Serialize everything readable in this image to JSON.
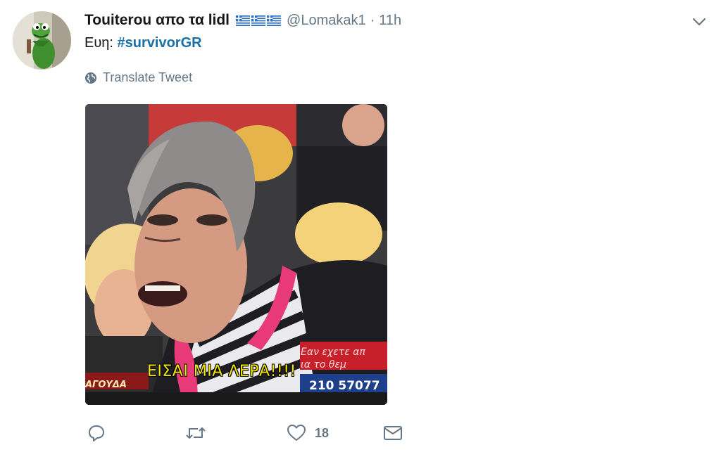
{
  "tweet": {
    "display_name": "Touiterou απο τα lidl",
    "flags": [
      "greece-flag",
      "greece-flag",
      "greece-flag"
    ],
    "handle": "@Lomakak1",
    "separator": "·",
    "time": "11h",
    "text_prefix": "Ευη: ",
    "hashtag": "#survivorGR",
    "translate_label": "Translate Tweet",
    "media": {
      "subtitle": "ΕΙΣΑΙ ΜΙΑ ΛΕΡΑ!!!!",
      "ticker_line1": "Εαν εχετε απ",
      "ticker_line2": "ια  το θεμ",
      "phone": "210 57077",
      "location": "ΑΓΟΥΔΑ"
    },
    "actions": {
      "reply_icon": "reply-icon",
      "retweet_icon": "retweet-icon",
      "like_icon": "heart-icon",
      "like_count": "18",
      "dm_icon": "envelope-icon"
    },
    "colors": {
      "hashtag": "#1b6fa8",
      "muted": "#657786",
      "subtitle": "#f3e600"
    }
  }
}
